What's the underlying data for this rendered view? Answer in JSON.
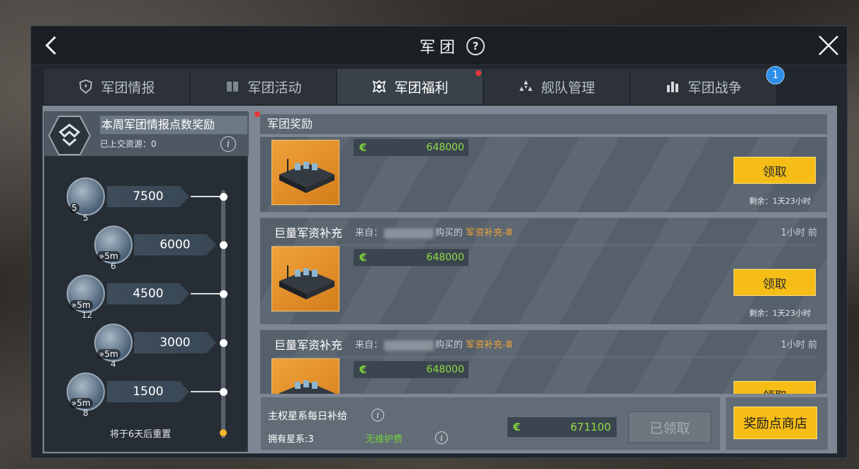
{
  "window": {
    "title": "军团",
    "help_icon": "question-icon"
  },
  "tabs": [
    {
      "label": "军团情报",
      "icon": "shield-icon",
      "active": false
    },
    {
      "label": "军团活动",
      "icon": "book-icon",
      "active": false
    },
    {
      "label": "军团福利",
      "icon": "gift-icon",
      "active": true,
      "alert": true
    },
    {
      "label": "舰队管理",
      "icon": "fleet-icon",
      "active": false
    },
    {
      "label": "军团战争",
      "icon": "war-icon",
      "active": false,
      "badge": "1"
    }
  ],
  "left_panel": {
    "title": "本周军团情报点数奖励",
    "submitted": "已上交资源：0",
    "milestones": [
      {
        "points": "7500",
        "count": "5",
        "tag": "5"
      },
      {
        "points": "6000",
        "count": "6",
        "tag": "»5m"
      },
      {
        "points": "4500",
        "count": "12",
        "tag": "»5m"
      },
      {
        "points": "3000",
        "count": "4",
        "tag": "»5m"
      },
      {
        "points": "1500",
        "count": "8",
        "tag": "»5m"
      }
    ],
    "reset_text": "将于6天后重置"
  },
  "rewards": {
    "section_title": "军团奖励",
    "cards": [
      {
        "title": "",
        "from": "",
        "time": "",
        "amount": "648000",
        "claim_label": "领取",
        "remain": "剩余：1天23小时"
      },
      {
        "title": "巨量军资补充",
        "from_prefix": "来自：",
        "from_suffix": "购买的",
        "item": "军资补充-Ⅲ",
        "time": "1小时 前",
        "amount": "648000",
        "claim_label": "领取",
        "remain": "剩余：1天23小时"
      },
      {
        "title": "巨量军资补充",
        "from_prefix": "来自：",
        "from_suffix": "购买的",
        "item": "军资补充-Ⅲ",
        "time": "1小时 前",
        "amount": "648000",
        "claim_label": "领取"
      }
    ]
  },
  "daily_supply": {
    "title": "主权星系每日补给",
    "owned": "拥有星系:3",
    "maintenance": "无维护费",
    "amount": "671100",
    "claimed_label": "已领取"
  },
  "shop_button": "奖励点商店",
  "colors": {
    "accent_yellow": "#f6bd17",
    "green_value": "#8ddc47",
    "badge_blue": "#2f8fe8",
    "alert_red": "#e53935"
  }
}
